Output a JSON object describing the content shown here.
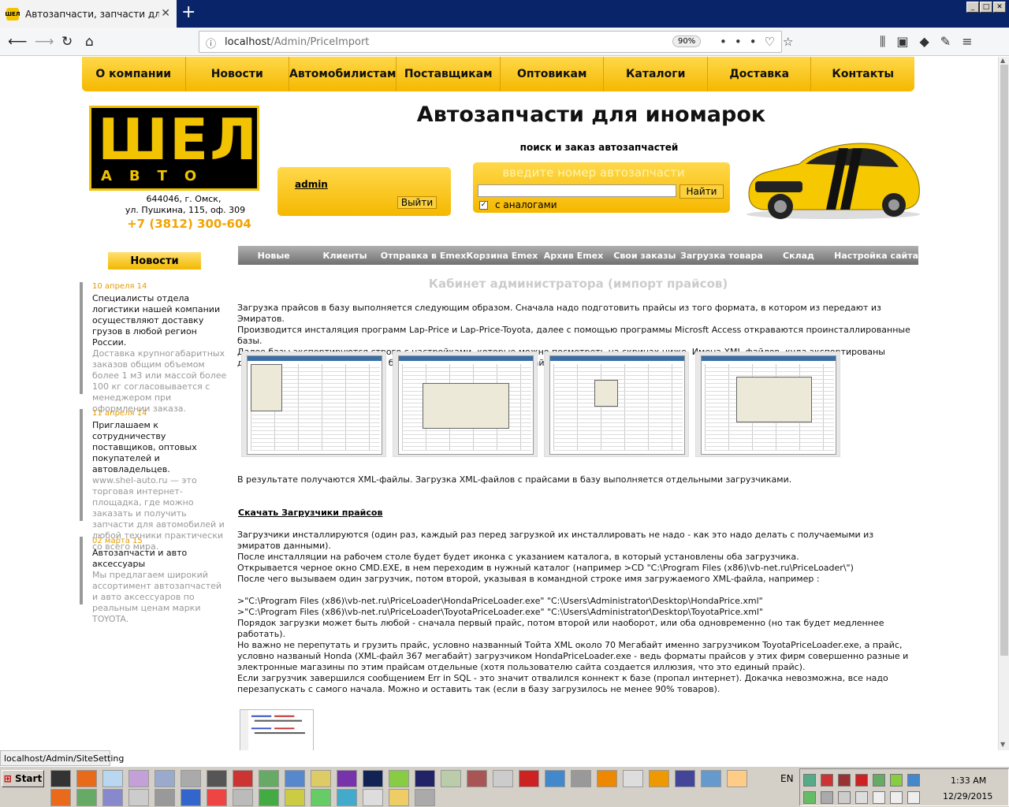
{
  "browser": {
    "tab_title": "Автозапчасти, запчасти для ино",
    "tab_logo": "ШЕЛ",
    "url_host": "localhost",
    "url_path": "/Admin/PriceImport",
    "zoom": "90%",
    "status_url": "localhost/Admin/SiteSetting"
  },
  "topmenu": [
    "О компании",
    "Новости",
    "Автомобилистам",
    "Поставщикам",
    "Оптовикам",
    "Каталоги",
    "Доставка",
    "Контакты"
  ],
  "logo": {
    "big": "ШЕЛ",
    "small": "АВТО"
  },
  "address": {
    "line1": "644046, г. Омск,",
    "line2": "ул. Пушкина, 115, оф. 309",
    "phone": "+7 (3812) 300-604"
  },
  "header": {
    "title": "Автозапчасти для иномарок",
    "subtitle": "поиск и заказ автозапчастей"
  },
  "login": {
    "user": "admin",
    "logout_label": "Выйти"
  },
  "search": {
    "placeholder": "введите номер автозапчасти",
    "button": "Найти",
    "analog_label": "с аналогами",
    "analog_checked": true
  },
  "news": {
    "button": "Новости",
    "items": [
      {
        "date": "10 апреля 14",
        "title": "Специалисты отдела логистики нашей компании осуществляют доставку грузов в любой регион России.",
        "body": "Доставка крупногабаритных заказов общим объемом более 1 м3 или массой более 100 кг согласовывается с менеджером при оформлении заказа."
      },
      {
        "date": "11 апреля 14",
        "title": "Приглашаем к сотрудничеству поставщиков, оптовых покупателей и автовладельцев.",
        "body": "www.shel-auto.ru — это торговая интернет-площадка, где можно заказать и получить запчасти для автомобилей и любой техники практически со всего мира."
      },
      {
        "date": "02 марта 15",
        "title": "Автозапчасти и авто аксессуары",
        "body": "Мы предлагаем широкий ассортимент автозапчастей и авто аксессуаров по реальным ценам марки TOYOTA."
      }
    ]
  },
  "submenu": [
    "Новые",
    "Клиенты",
    "Отправка в Emex",
    "Корзина Emex",
    "Архив Emex",
    "Свои заказы",
    "Загрузка товара",
    "Склад",
    "Настройка сайта"
  ],
  "content": {
    "title": "Кабинет администратора (импорт прайсов)",
    "p1": [
      "Загрузка прайсов в базу выполняется следующим образом. Сначала надо подготовить прайсы из того формата, в котором из передают из Эмиратов.",
      "Производится инсталяция программ Lap-Price и Lap-Price-Toyota, далее с помощью программы Microsft Access откраваются проинсталлированные базы.",
      "Далее базы экспортируются строго с настройками, которые можно посмотреть на скринах ниже. Имена XML-файлов, куда экспортированы данные запоминаются - их надо будет указывать загрузчику прайсов."
    ],
    "p2": "В результате получаются XML-файлы. Загрузка XML-файлов с прайсами в базу выполняется отдельными загрузчиками.",
    "download_link": "Скачать Загрузчики прайсов",
    "p3": [
      "Загрузчики инсталлируются (один раз, каждый раз перед загрузкой их инсталлировать не надо - как это надо делать с получаемыми из эмиратов данными).",
      "После инсталляции на рабочем столе будет будет иконка с указанием каталога, в который установлены оба загрузчика.",
      "Открывается черное окно CMD.EXE, в нем переходим в нужный каталог (например >CD \"C:\\Program Files (x86)\\vb-net.ru\\PriceLoader\\\")",
      "После чего вызываем один загрузчик, потом второй, указывая в командной строке имя загружаемого XML-файла, например :"
    ],
    "cmd1": ">\"C:\\Program Files (x86)\\vb-net.ru\\PriceLoader\\HondaPriceLoader.exe\" \"C:\\Users\\Administrator\\Desktop\\HondaPrice.xml\"",
    "cmd2": ">\"C:\\Program Files (x86)\\vb-net.ru\\PriceLoader\\ToyotaPriceLoader.exe\" \"C:\\Users\\Administrator\\Desktop\\ToyotaPrice.xml\"",
    "p4": [
      "Порядок загрузки может быть любой - сначала первый прайс, потом второй или наоборот, или оба одновременно (но так будет медленнее работать).",
      "Но важно не перепутать и грузить прайс, условно названный Тойта XML около 70 Мегабайт именно загрузчиком ToyotaPriceLoader.exe, а прайс, условно названый Honda (XML-файл 367 мегабайт) загрузчиком HondaPriceLoader.exe - ведь форматы прайсов у этих фирм совершенно разные и электронные магазины по этим прайсам отдельные (хотя пользователю сайта создается иллюзия, что это единый прайс).",
      "Если загрузчик завершился сообщением Err in SQL - это значит отвалился коннект к базе (пропал интернет). Докачка невозможна, все надо перезапускать с самого начала. Можно и оставить так (если в базу загрузилось не менее 90% товаров)."
    ]
  },
  "taskbar": {
    "start": "Start",
    "lang": "EN",
    "time": "1:33 AM",
    "date": "12/29/2015"
  },
  "colors": {
    "accent": "#f2c300",
    "menu_dark": "#707070"
  }
}
